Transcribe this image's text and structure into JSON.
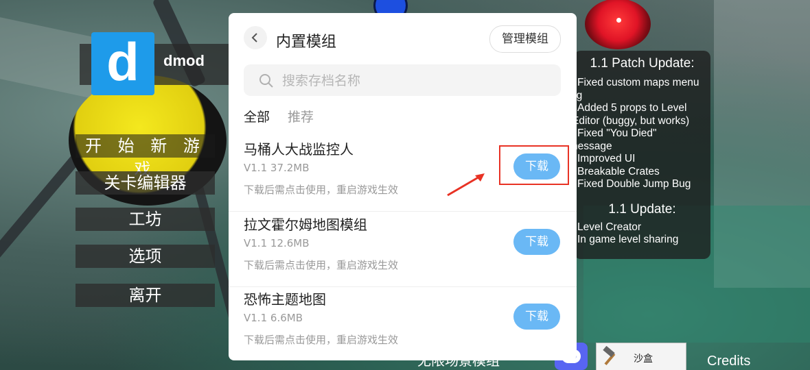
{
  "game": {
    "logo_letter": "d",
    "logo_text": "dmod",
    "menu": [
      "开 始 新 游 戏",
      "关卡编辑器",
      "工坊",
      "选项",
      "离开"
    ],
    "patch_notes": {
      "title1": "1.1 Patch Update:",
      "lines1": [
        "Fixed custom maps menu",
        "ag",
        "Added 5 props to Level",
        "Editor (buggy, but works)",
        "Fixed \"You Died\"",
        "nessage",
        "Improved UI",
        "Breakable Crates",
        "Fixed Double Jump Bug"
      ],
      "title2": "1.1 Update:",
      "lines2": [
        "Level Creator",
        "In game level sharing"
      ]
    },
    "bottom_text": "无限场景模组",
    "sandbox_label": "沙盒",
    "credits_label": "Credits"
  },
  "modal": {
    "title": "内置模组",
    "manage_label": "管理模组",
    "search_placeholder": "搜索存档名称",
    "tabs": [
      "全部",
      "推荐"
    ],
    "items": [
      {
        "name": "马桶人大战监控人",
        "version": "V1.1",
        "size": "37.2MB",
        "hint": "下载后需点击使用，重启游戏生效",
        "action": "下载"
      },
      {
        "name": "拉文霍尔姆地图模组",
        "version": "V1.1",
        "size": "12.6MB",
        "hint": "下载后需点击使用，重启游戏生效",
        "action": "下载"
      },
      {
        "name": "恐怖主题地图",
        "version": "V1.1",
        "size": "6.6MB",
        "hint": "下载后需点击使用，重启游戏生效",
        "action": "下载"
      }
    ]
  },
  "colors": {
    "download_button": "#6ab8f5",
    "highlight": "#e83224",
    "logo_blue": "#1e9bea"
  }
}
